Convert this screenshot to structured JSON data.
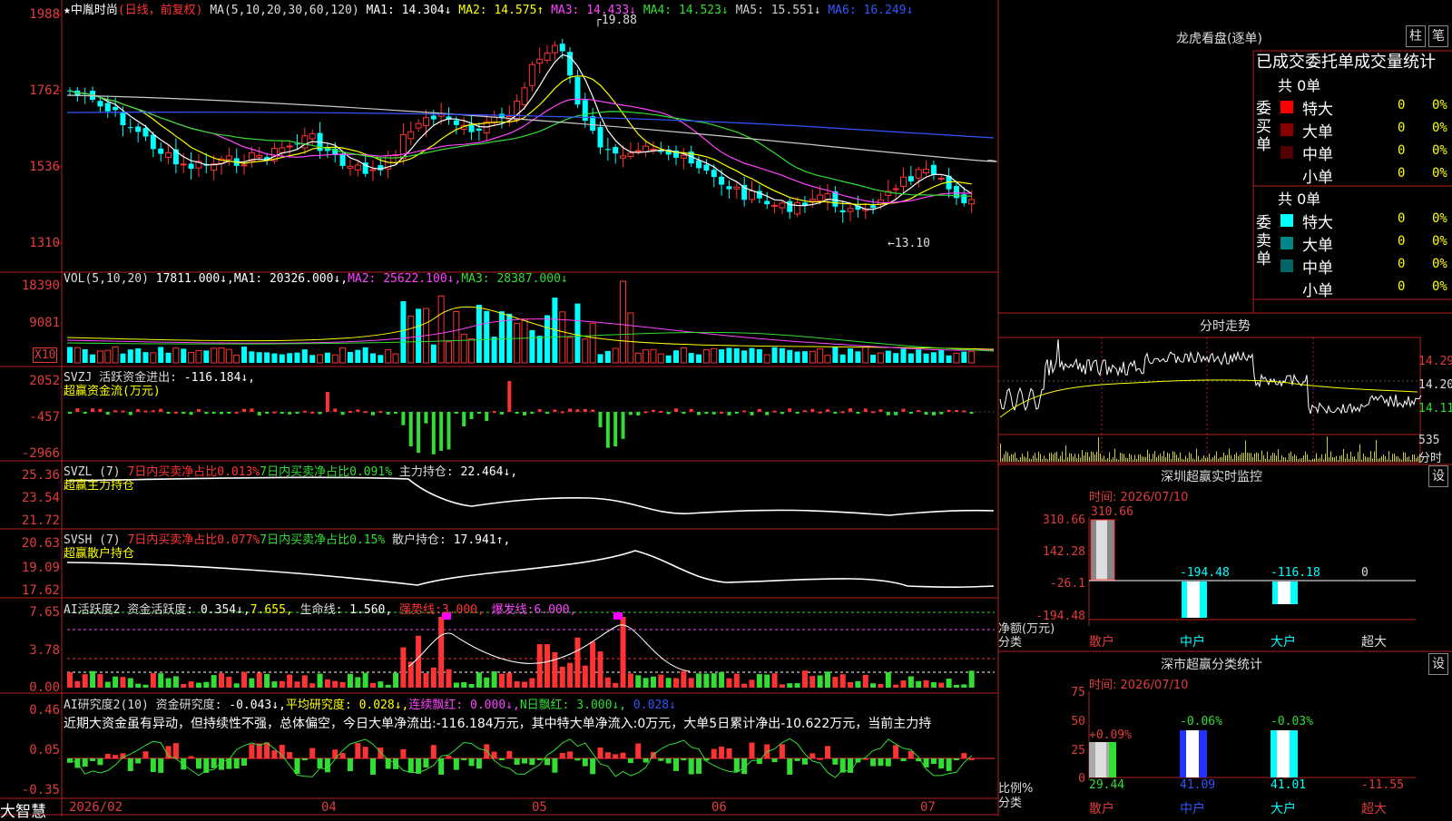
{
  "main": {
    "star": "★",
    "stock_name": "中胤时尚",
    "period": "(日线，前复权)",
    "ma_label": "MA(5,10,20,30,60,120)",
    "ma": [
      {
        "label": "MA1:",
        "value": "14.304↓",
        "color": "#ffffff"
      },
      {
        "label": "MA2:",
        "value": "14.575↑",
        "color": "#ffff00"
      },
      {
        "label": "MA3:",
        "value": "14.433↓",
        "color": "#ff44ff"
      },
      {
        "label": "MA4:",
        "value": "14.523↓",
        "color": "#33dd33"
      },
      {
        "label": "MA5:",
        "value": "15.551↓",
        "color": "#cccccc"
      },
      {
        "label": "MA6:",
        "value": "16.249↓",
        "color": "#3355ff"
      }
    ],
    "high_label": "19.88",
    "low_label": "←13.10",
    "yaxis": [
      "1988",
      "1762",
      "1536",
      "1310"
    ],
    "tag": "X10"
  },
  "vol": {
    "label": "VOL(5,10,20)",
    "value": "17811.000↓,",
    "ma": [
      {
        "label": "MA1:",
        "value": "20326.000↓,",
        "color": "#ffffff"
      },
      {
        "label": "MA2:",
        "value": "25622.100↓,",
        "color": "#ff44ff"
      },
      {
        "label": "MA3:",
        "value": "28387.000↓",
        "color": "#33dd33"
      }
    ],
    "yaxis": [
      "18390",
      "9081"
    ]
  },
  "svzj": {
    "label": "SVZJ",
    "desc": "活跃资金进出:",
    "value": "-116.184↓,",
    "sub": "超赢资金流(万元)",
    "yaxis": [
      "2052",
      "-457",
      "-2966"
    ]
  },
  "svzl": {
    "label": "SVZL (7)",
    "a": "7日内买卖净占比0.013%",
    "b": "7日内买卖净占比0.091%",
    "c": "主力持仓:",
    "cv": "22.464↓,",
    "sub": "超赢主力持仓",
    "yaxis": [
      "25.36",
      "23.54",
      "21.72"
    ]
  },
  "svsh": {
    "label": "SVSH (7)",
    "a": "7日内买卖净占比0.077%",
    "b": "7日内买卖净占比0.15%",
    "c": "散户持仓:",
    "cv": "17.941↑,",
    "sub": "超赢散户持仓",
    "yaxis": [
      "20.63",
      "19.09",
      "17.62"
    ]
  },
  "ai1": {
    "label": "AI活跃度2",
    "desc": "资金活跃度:",
    "v1": "0.354↓,",
    "v2": "7.655,",
    "l1": "生命线:",
    "v3": "1.560,",
    "l2": "强势线:",
    "v4": "3.000,",
    "l3": "爆发线:",
    "v5": "6.000,",
    "yaxis": [
      "7.65",
      "3.78",
      "0.00"
    ]
  },
  "ai2": {
    "label": "AI研究度2(10)",
    "l1": "资金研究度:",
    "v1": "-0.043↓,",
    "l2": "平均研究度:",
    "v2": "0.028↓,",
    "l3": "连续飘红:",
    "v3": "0.000↓,",
    "l4": "N日飘红:",
    "v4": "3.000↓,",
    "v5": "0.028↓",
    "text": "近期大资金虽有异动，但持续性不强，总体偏空，今日大单净流出:-116.184万元，其中特大单净流入:0万元，大单5日累计净出-10.622万元，当前主力持",
    "yaxis": [
      "0.46",
      "0.05",
      "-0.35"
    ]
  },
  "xaxis": [
    "2026/02",
    "04",
    "05",
    "06",
    "07"
  ],
  "brand": "大智慧",
  "right": {
    "lhb_title": "龙虎看盘(逐单)",
    "btn1": "柱",
    "btn2": "笔",
    "subtitle": "已成交委托单成交量统计",
    "buy_total": "共 0单",
    "buy_label": "委买单",
    "sell_total": "共 0单",
    "sell_label": "委卖单",
    "buy_rows": [
      {
        "name": "特大",
        "v": "0",
        "p": "0%",
        "color": "#ff0000"
      },
      {
        "name": "大单",
        "v": "0",
        "p": "0%",
        "color": "#880000"
      },
      {
        "name": "中单",
        "v": "0",
        "p": "0%",
        "color": "#550000"
      },
      {
        "name": "小单",
        "v": "0",
        "p": "0%",
        "color": "#000000"
      }
    ],
    "sell_rows": [
      {
        "name": "特大",
        "v": "0",
        "p": "0%",
        "color": "#00ffff"
      },
      {
        "name": "大单",
        "v": "0",
        "p": "0%",
        "color": "#008888"
      },
      {
        "name": "中单",
        "v": "0",
        "p": "0%",
        "color": "#006666"
      },
      {
        "name": "小单",
        "v": "0",
        "p": "0%",
        "color": "#000000"
      }
    ],
    "trend_title": "分时走势",
    "trend_y": [
      "14.29",
      "14.20",
      "14.11"
    ],
    "trend_vol": "535",
    "trend_unit": "分时",
    "mon_title": "深圳超赢实时监控",
    "mon_btn": "设",
    "mon_time": "时间: 2026/07/10",
    "mon_y": [
      "310.66",
      "142.28",
      "-26.1",
      "-194.48"
    ],
    "mon_ylabel": "净额(万元)",
    "mon_xlabel": "分类",
    "mon_vals": [
      "310.66",
      "-194.48",
      "-116.18",
      "0"
    ],
    "mon_cats": [
      "散户",
      "中户",
      "大户",
      "超大"
    ],
    "cls_title": "深市超赢分类统计",
    "cls_btn": "设",
    "cls_time": "时间: 2026/07/10",
    "cls_y": [
      "75",
      "50",
      "25",
      "0"
    ],
    "cls_ylabel": "比例%",
    "cls_xlabel": "分类",
    "cls_top": [
      "+0.09%",
      "-0.06%",
      "-0.03%"
    ],
    "cls_bot": [
      "29.44",
      "41.09",
      "41.01",
      "-11.55"
    ],
    "cls_cats": [
      "散户",
      "中户",
      "大户",
      "超大"
    ]
  }
}
